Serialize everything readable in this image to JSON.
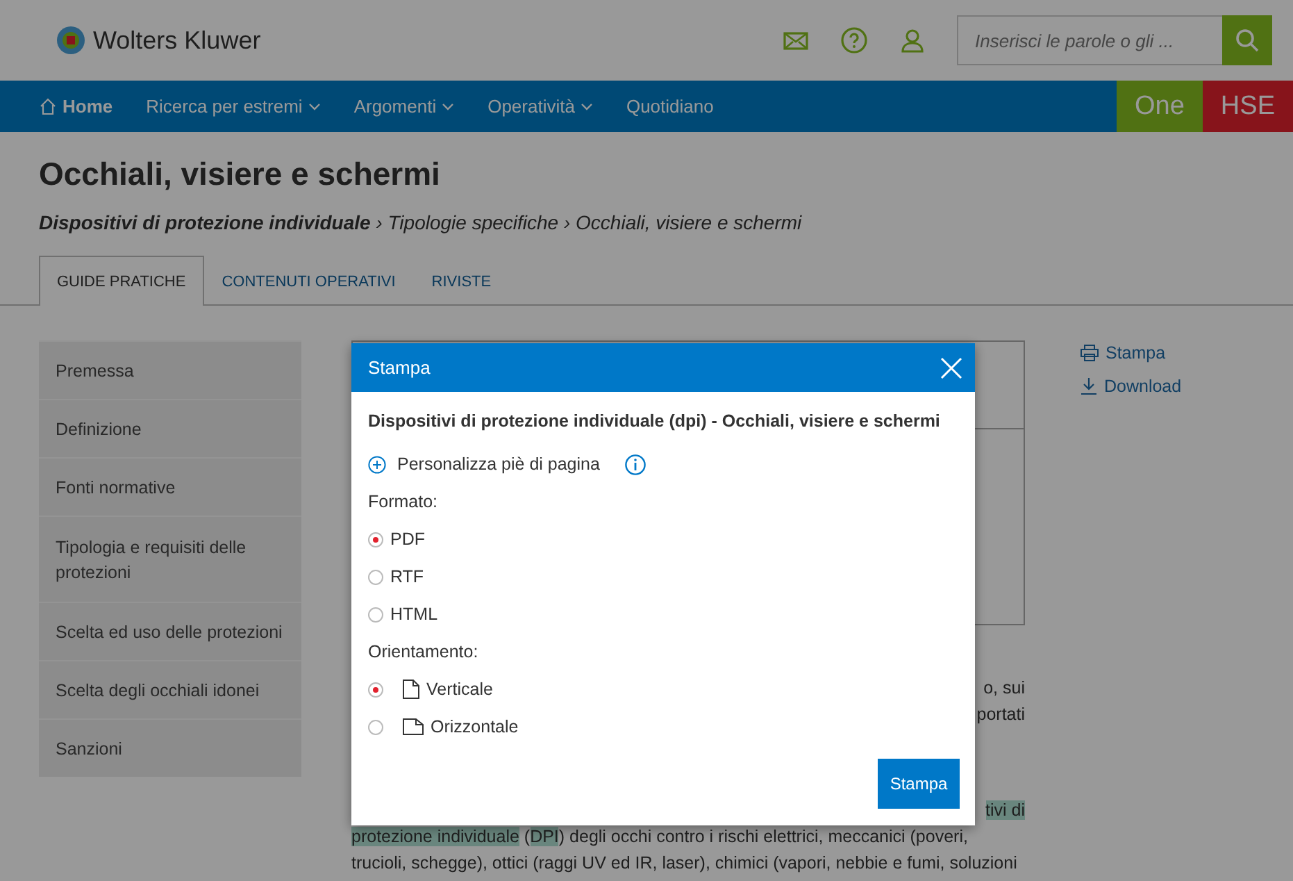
{
  "header": {
    "logo_text": "Wolters Kluwer",
    "search": {
      "placeholder": "Inserisci le parole o gli ..."
    }
  },
  "nav": {
    "items": [
      {
        "label": "Home",
        "kind": "home",
        "selected": true
      },
      {
        "label": "Ricerca per estremi",
        "kind": "dropdown",
        "selected": false
      },
      {
        "label": "Argomenti",
        "kind": "dropdown",
        "selected": false
      },
      {
        "label": "Operatività",
        "kind": "dropdown",
        "selected": false
      },
      {
        "label": "Quotidiano",
        "kind": "link",
        "selected": false
      }
    ],
    "products": [
      {
        "label": "One",
        "kind": "one"
      },
      {
        "label": "HSE",
        "kind": "hse"
      }
    ]
  },
  "page": {
    "title": "Occhiali, visiere e schermi",
    "breadcrumb": "**Dispositivi di protezione individuale** › Tipologie specifiche › Occhiali, visiere e schermi",
    "tabs": [
      {
        "label": "GUIDE PRATICHE",
        "selected": true
      },
      {
        "label": "CONTENUTI OPERATIVI",
        "selected": false
      },
      {
        "label": "RIVISTE",
        "selected": false
      }
    ]
  },
  "sidebar": {
    "items": [
      {
        "label": "Premessa"
      },
      {
        "label": "Definizione"
      },
      {
        "label": "Fonti normative"
      },
      {
        "label": "Tipologia e requisiti delle protezioni"
      },
      {
        "label": "Scelta ed uso delle protezioni"
      },
      {
        "label": "Scelta degli occhiali idonei"
      },
      {
        "label": "Sanzioni"
      }
    ]
  },
  "article": {
    "paragraphs": [
      {
        "lines": [
          {
            "kind": "cut",
            "segments": [
              {
                "text": "o, sui",
                "highlighted": false
              }
            ]
          },
          {
            "kind": "cut",
            "segments": [
              {
                "text": "portati",
                "highlighted": false
              }
            ]
          }
        ]
      },
      {
        "lines": [
          {
            "kind": "cut",
            "segments": [
              {
                "text": "tivi di",
                "highlighted": true
              }
            ]
          },
          {
            "kind": "full",
            "segments": [
              {
                "text": "protezione individuale",
                "highlighted": true
              },
              {
                "text": " (",
                "highlighted": false
              },
              {
                "text": "DPI",
                "highlighted": true
              },
              {
                "text": ") degli occhi contro i rischi elettrici, meccanici (poveri,",
                "highlighted": false
              }
            ]
          },
          {
            "kind": "full",
            "segments": [
              {
                "text": "trucioli, schegge), ottici (raggi UV ed IR, laser), chimici (vapori, nebbie e fumi, soluzioni",
                "highlighted": false
              }
            ]
          }
        ]
      }
    ]
  },
  "actions": [
    {
      "label": "Stampa",
      "kind": "print"
    },
    {
      "label": "Download",
      "kind": "download"
    }
  ],
  "dialog": {
    "title": "Stampa",
    "document_title": "Dispositivi di protezione individuale (dpi) - Occhiali, visiere e schermi",
    "footer_option": "Personalizza piè di pagina",
    "format_label": "Formato:",
    "formats": [
      {
        "label": "PDF",
        "selected": true
      },
      {
        "label": "RTF",
        "selected": false
      },
      {
        "label": "HTML",
        "selected": false
      }
    ],
    "orientation_label": "Orientamento:",
    "orientations": [
      {
        "label": "Verticale",
        "kind": "portrait",
        "selected": true
      },
      {
        "label": "Orizzontale",
        "kind": "landscape",
        "selected": false
      }
    ],
    "button": "Stampa"
  }
}
